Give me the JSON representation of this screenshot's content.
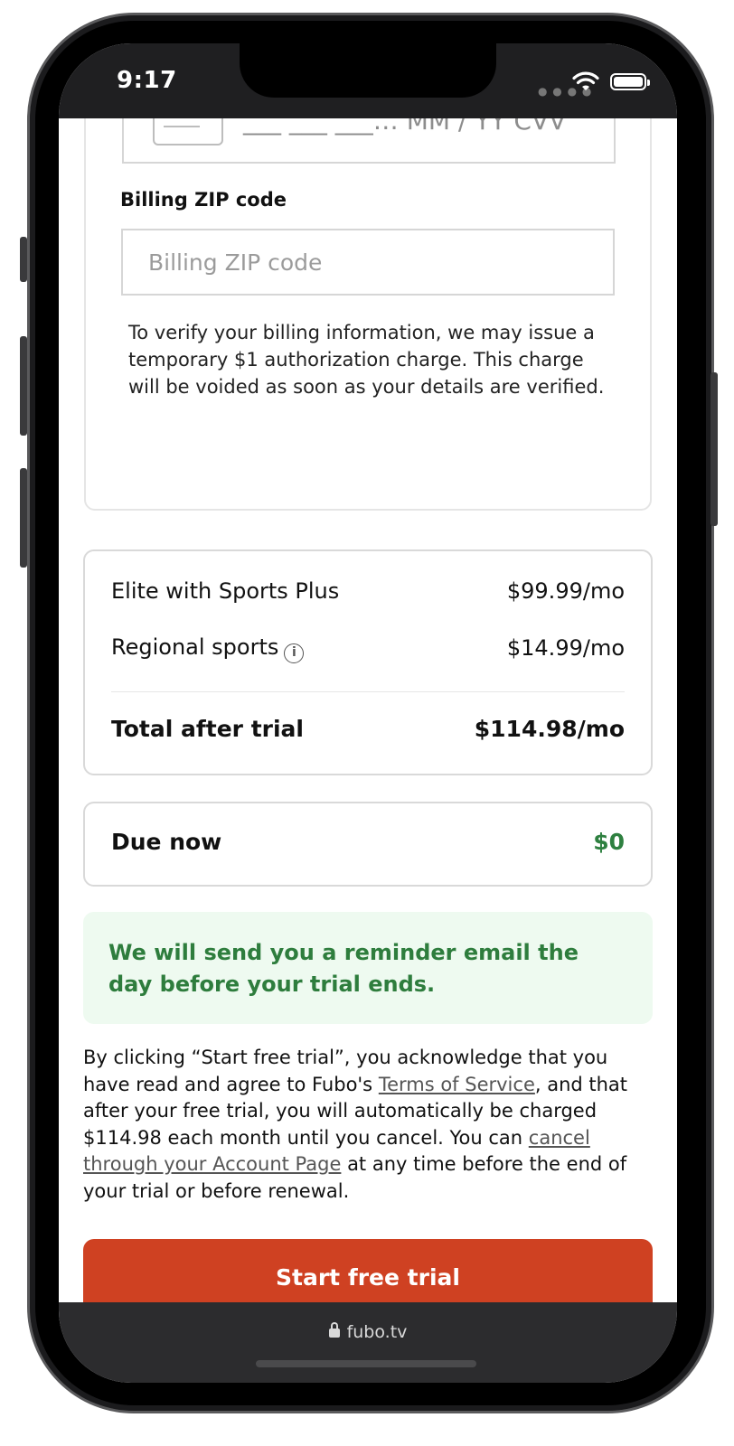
{
  "status_bar": {
    "time": "9:17",
    "signal_icon": "cellular-dots-icon",
    "wifi_icon": "wifi-icon",
    "battery_icon": "battery-icon"
  },
  "payment": {
    "card_placeholder": "___ ___ ___… MM / YY CVV",
    "card_icon": "credit-card-icon",
    "zip_label": "Billing ZIP code",
    "zip_placeholder": "Billing ZIP code",
    "zip_value": "",
    "verify_note": "To verify your billing information, we may issue a temporary $1 authorization charge. This charge will be voided as soon as your details are verified."
  },
  "pricing": {
    "items": [
      {
        "label": "Elite with Sports Plus",
        "price": "$99.99/mo"
      },
      {
        "label": "Regional sports",
        "price": "$14.99/mo",
        "icon": "info-icon"
      }
    ],
    "total_label": "Total after trial",
    "total_price": "$114.98/mo"
  },
  "due": {
    "label": "Due now",
    "amount": "$0",
    "amount_color": "#2e8040"
  },
  "reminder": {
    "text": "We will send you a reminder email the day before your trial ends.",
    "background": "#eefaf0",
    "text_color": "#2e7d3d"
  },
  "legal": {
    "part1": "By clicking “Start free trial”, you acknowledge that you have read and agree to Fubo's ",
    "terms_link": "Terms of Service",
    "part2": ", and that after your free trial, you will automatically be charged $114.98 each month until you cancel. You can ",
    "cancel_link": "cancel through your Account Page",
    "part3": " at any time before the end of your trial or before renewal."
  },
  "cta": {
    "label": "Start free trial",
    "color": "#cf4122"
  },
  "browser": {
    "url": "fubo.tv",
    "lock_icon": "lock-icon"
  }
}
